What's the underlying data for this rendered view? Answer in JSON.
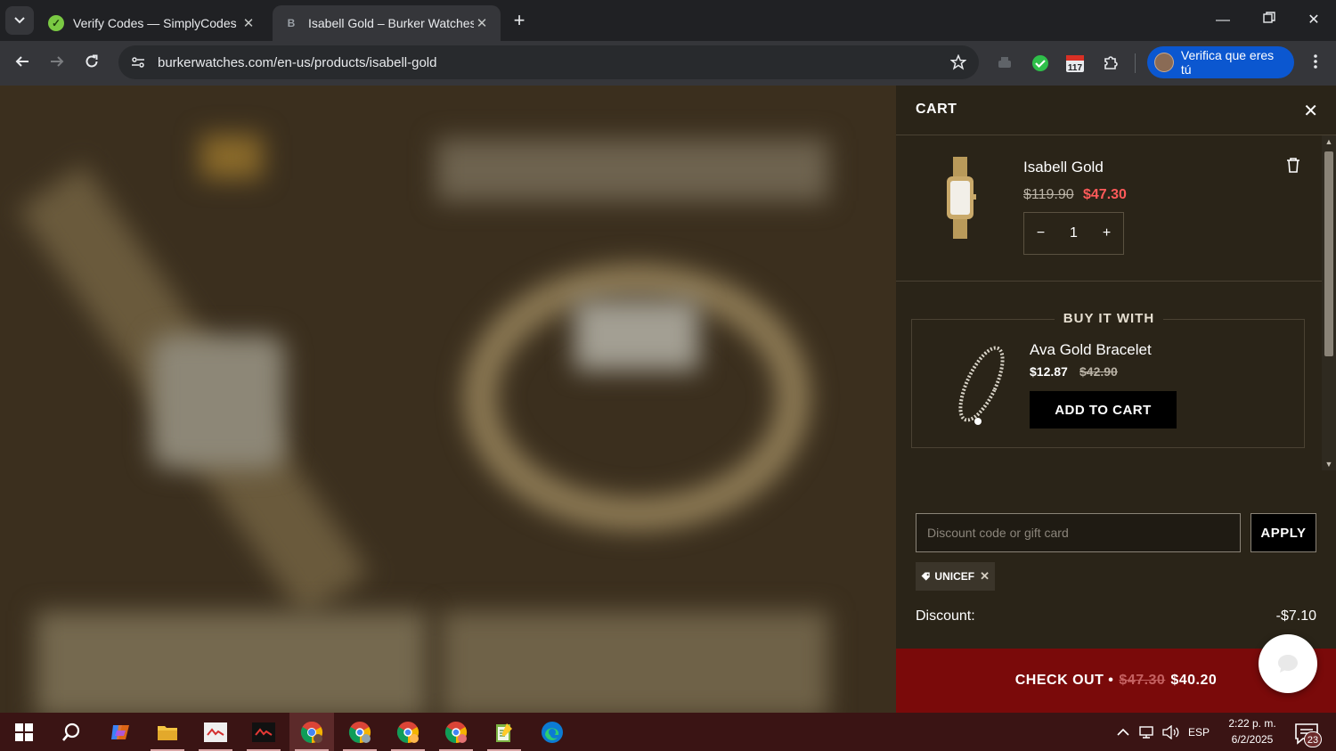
{
  "browser": {
    "tabs": [
      {
        "title": "Verify Codes — SimplyCodes",
        "favicon": "simplycodes-icon",
        "active": false
      },
      {
        "title": "Isabell Gold – Burker Watches",
        "favicon": "burker-b-icon",
        "active": true
      }
    ],
    "url": "burkerwatches.com/en-us/products/isabell-gold",
    "profile_label": "Verifica que eres tú",
    "extension_badge": "117"
  },
  "cart": {
    "title": "CART",
    "item": {
      "name": "Isabell Gold",
      "price_original": "$119.90",
      "price_sale": "$47.30",
      "quantity": "1",
      "decrease_label": "−",
      "increase_label": "+"
    },
    "upsell": {
      "heading": "BUY IT WITH",
      "name": "Ava Gold Bracelet",
      "price_sale": "$12.87",
      "price_original": "$42.90",
      "button_label": "ADD TO CART"
    },
    "discount": {
      "placeholder": "Discount code or gift card",
      "apply_label": "APPLY",
      "applied_code": "UNICEF",
      "label": "Discount:",
      "value": "-$7.10"
    },
    "checkout": {
      "label": "CHECK OUT •",
      "price_original": "$47.30",
      "price_final": "$40.20"
    }
  },
  "taskbar": {
    "language": "ESP",
    "time": "2:22 p. m.",
    "date": "6/2/2025",
    "notification_count": "23"
  },
  "colors": {
    "sale_red": "#ff5a5a",
    "checkout_bg": "#7a0a0a",
    "drawer_bg": "#2a2418",
    "profile_blue": "#0b57d0"
  }
}
